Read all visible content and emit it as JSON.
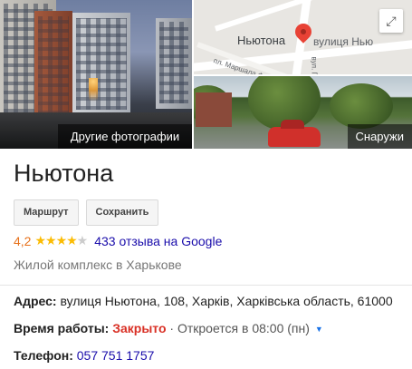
{
  "photos": {
    "main_caption": "Другие фотографии",
    "street_caption": "Снаружи"
  },
  "map": {
    "place_label": "Ньютона",
    "street_label": "вулиця Нью",
    "small_label": "пл. Маршала Федоренка",
    "vertical_label": "вул. Га"
  },
  "place": {
    "title": "Ньютона",
    "buttons": {
      "route": "Маршрут",
      "save": "Сохранить"
    },
    "rating_value": "4,2",
    "rating_stars": 4.2,
    "reviews_text": "433 отзыва на Google",
    "category": "Жилой комплекс в Харькове"
  },
  "details": {
    "address_label": "Адрес:",
    "address_value": "вулиця Ньютона, 108, Харків, Харківська область, 61000",
    "hours_label": "Время работы:",
    "hours_status": "Закрыто",
    "hours_next": "· Откроется в 08:00 (пн)",
    "phone_label": "Телефон:",
    "phone_value": "057 751 1757"
  },
  "colors": {
    "accent_orange": "#e7711b",
    "star": "#fbbc04",
    "link": "#1a0dab",
    "closed": "#d93025"
  }
}
